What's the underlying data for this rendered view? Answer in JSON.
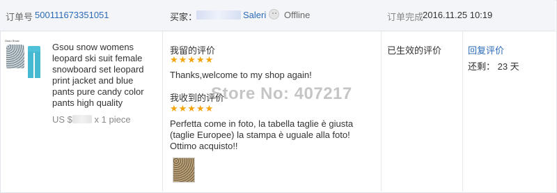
{
  "header": {
    "order_label": "订单号",
    "order_number": "500111673351051",
    "buyer_label": "买家：",
    "buyer_name": "Saleri",
    "status": "Offline",
    "completed_label": "订单完成",
    "completed_date": "2016.11.25 10:19"
  },
  "product": {
    "image_brand": "Gsou Snow",
    "title": "Gsou snow womens leopard ski suit female snowboard set leopard print jacket and blue pants pure candy color pants high quality",
    "price_prefix": "US $",
    "quantity_text": "x 1 piece"
  },
  "feedback": {
    "my_label": "我留的评价",
    "my_stars": "★★★★★",
    "my_comment": "Thanks,welcome to my shop again!",
    "received_label": "我收到的评价",
    "received_stars": "★★★★★",
    "received_comment": "Perfetta come in foto, la tabella taglie è giusta (taglie Europee) la stampa è uguale alla foto! Ottimo acquisto!!",
    "watermark": "Store No: 407217"
  },
  "actions": {
    "status_text": "已生效的评价",
    "reply_link": "回复评价",
    "remaining": "还剩： 23 天"
  }
}
